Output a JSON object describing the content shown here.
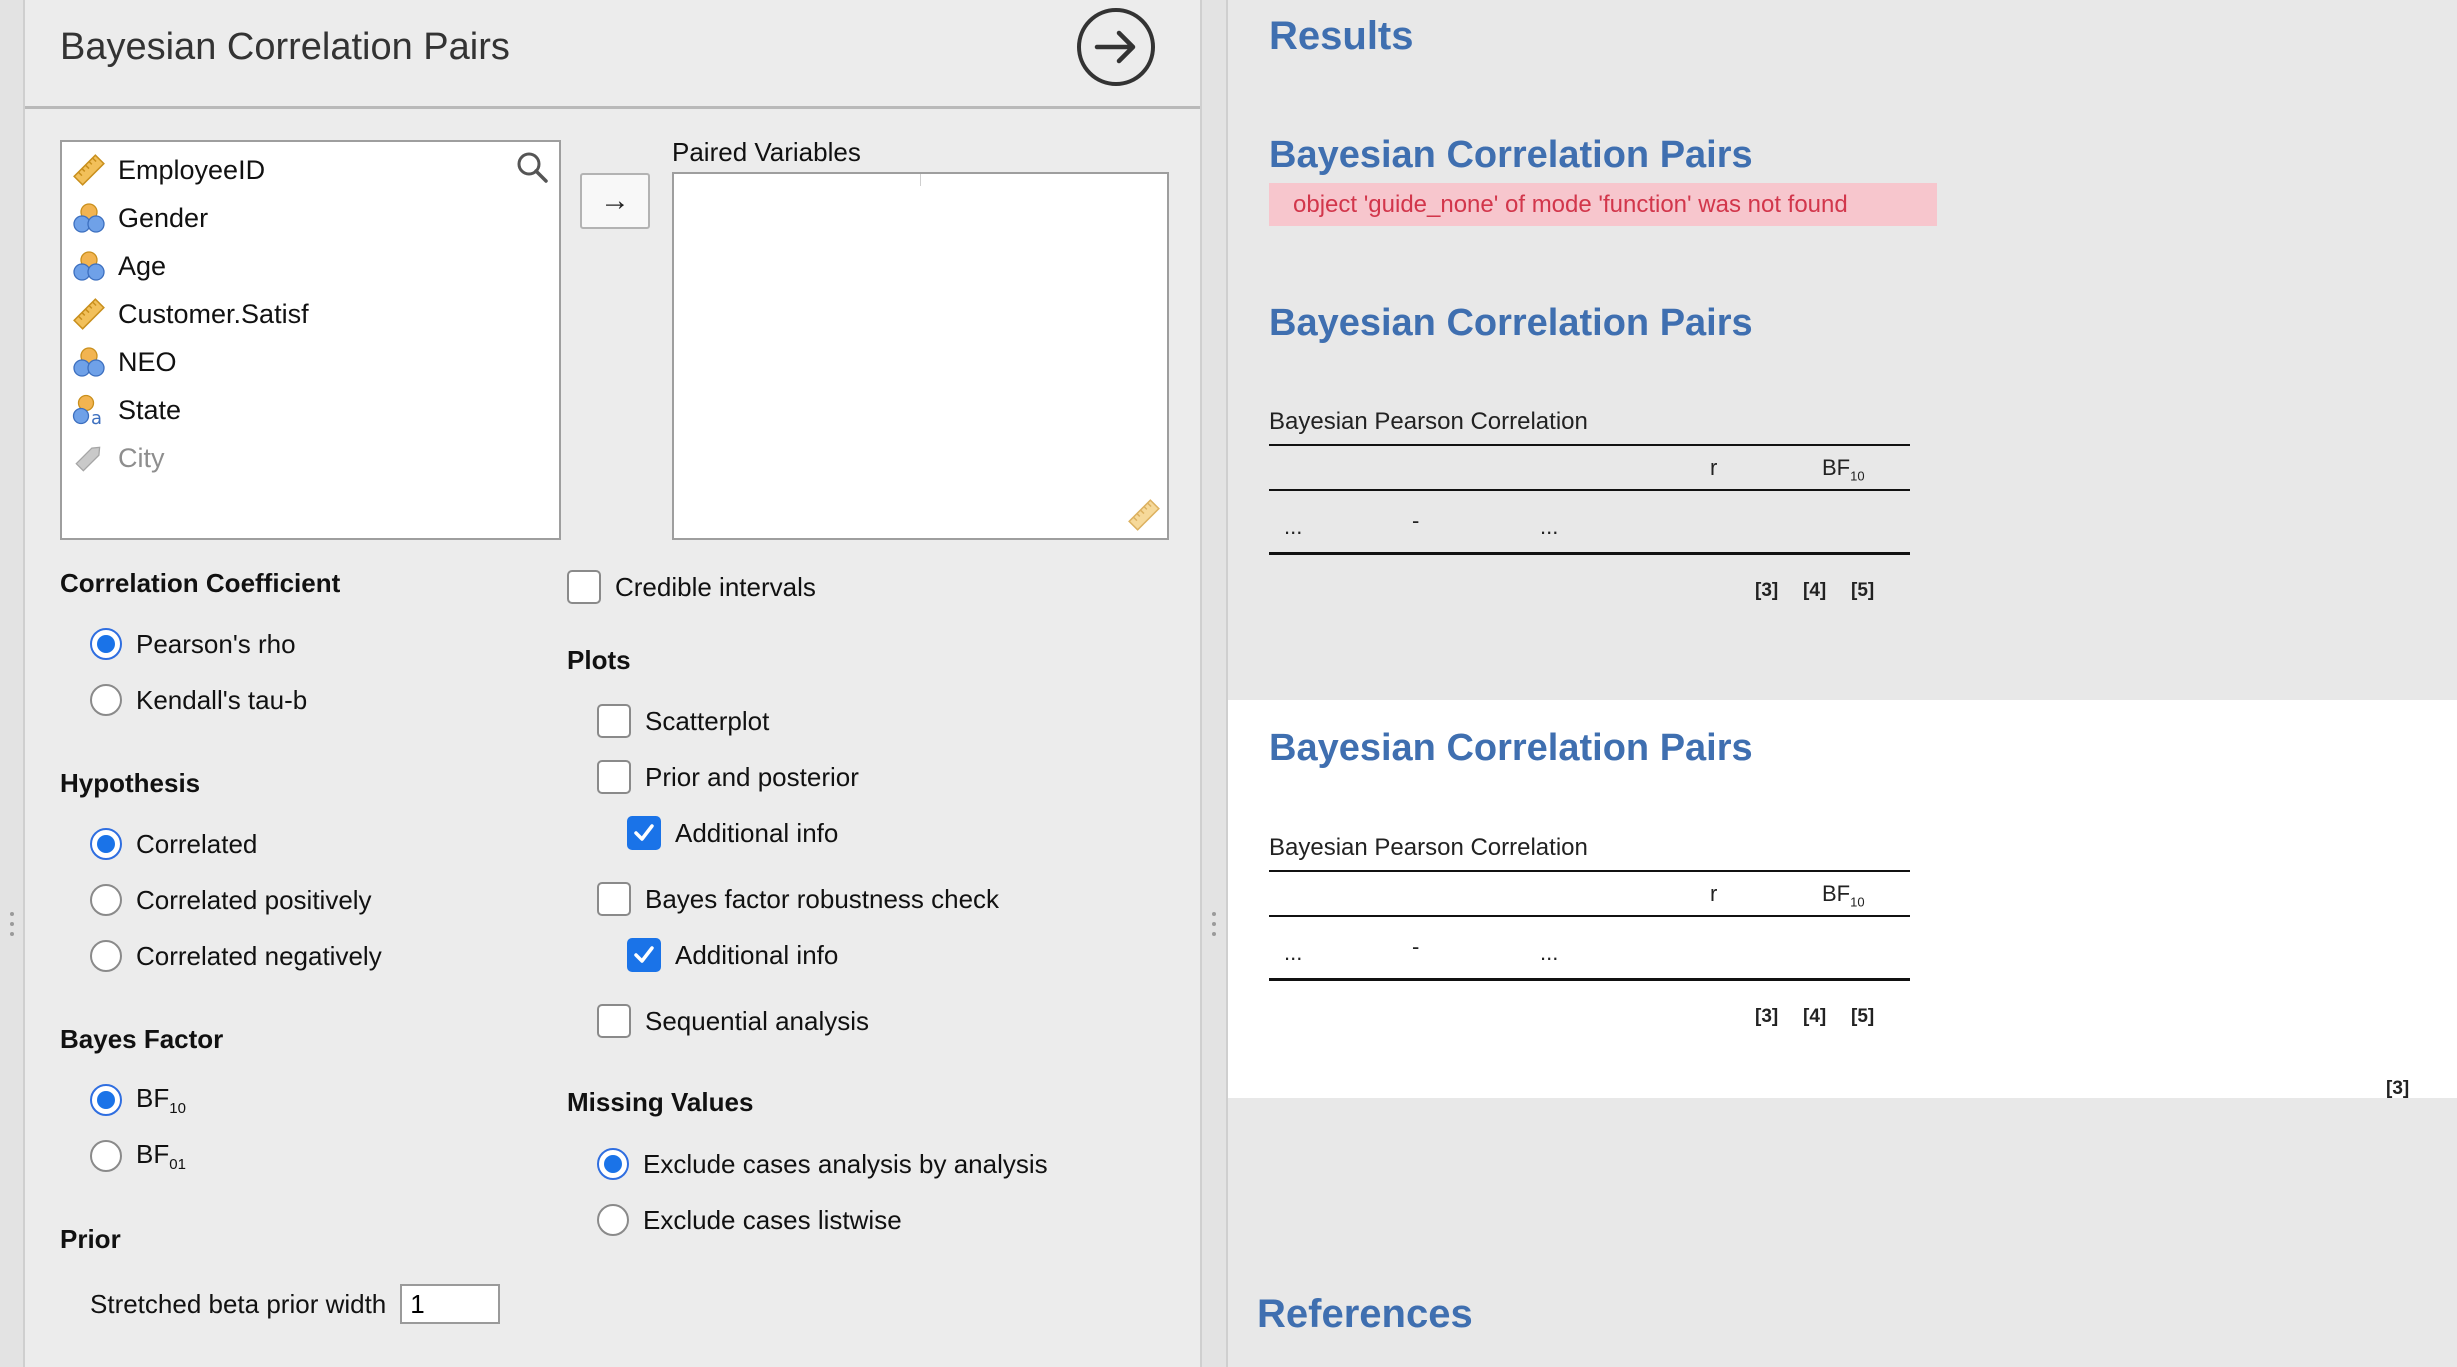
{
  "analysis": {
    "title": "Bayesian Correlation Pairs"
  },
  "variables": [
    {
      "name": "EmployeeID",
      "icon": "scale-icon",
      "enabled": true
    },
    {
      "name": "Gender",
      "icon": "nominal-icon",
      "enabled": true
    },
    {
      "name": "Age",
      "icon": "nominal-icon",
      "enabled": true
    },
    {
      "name": "Customer.Satisf",
      "icon": "scale-icon",
      "enabled": true
    },
    {
      "name": "NEO",
      "icon": "nominal-icon",
      "enabled": true
    },
    {
      "name": "State",
      "icon": "nominal-text-icon",
      "enabled": true
    },
    {
      "name": "City",
      "icon": "text-icon",
      "enabled": false
    }
  ],
  "paired": {
    "label": "Paired Variables",
    "move_glyph": "→"
  },
  "correlation": {
    "label": "Correlation Coefficient",
    "options": [
      "Pearson's rho",
      "Kendall's tau-b"
    ],
    "selected": 0
  },
  "hypothesis": {
    "label": "Hypothesis",
    "options": [
      "Correlated",
      "Correlated positively",
      "Correlated negatively"
    ],
    "selected": 0
  },
  "bayes_factor": {
    "label": "Bayes Factor",
    "options": [
      {
        "main": "BF",
        "sub": "10"
      },
      {
        "main": "BF",
        "sub": "01"
      }
    ],
    "selected": 0
  },
  "prior": {
    "label": "Prior",
    "field_label": "Stretched beta prior width",
    "value": "1"
  },
  "credible_intervals": {
    "label": "Credible intervals",
    "checked": false
  },
  "plots": {
    "label": "Plots",
    "scatterplot": "Scatterplot",
    "prior_posterior": "Prior and posterior",
    "additional_info_1": "Additional info",
    "robustness": "Bayes factor robustness check",
    "additional_info_2": "Additional info",
    "sequential": "Sequential analysis"
  },
  "missing": {
    "label": "Missing Values",
    "options": [
      "Exclude cases analysis by analysis",
      "Exclude cases listwise"
    ],
    "selected": 0
  },
  "results": {
    "heading": "Results",
    "blocks": [
      {
        "title": "Bayesian Correlation Pairs",
        "error": "object 'guide_none' of mode 'function' was not found"
      },
      {
        "title": "Bayesian Correlation Pairs",
        "table_title": "Bayesian Pearson Correlation",
        "col_r": "r",
        "col_bf_main": "BF",
        "col_bf_sub": "10",
        "row": [
          "...",
          "-",
          "..."
        ],
        "footnotes": [
          "[3]",
          "[4]",
          "[5]"
        ]
      },
      {
        "title": "Bayesian Correlation Pairs",
        "table_title": "Bayesian Pearson Correlation",
        "col_r": "r",
        "col_bf_main": "BF",
        "col_bf_sub": "10",
        "row": [
          "...",
          "-",
          "..."
        ],
        "footnotes": [
          "[3]",
          "[4]",
          "[5]"
        ],
        "extra_footnote": "[3]"
      }
    ],
    "references": "References"
  },
  "colors": {
    "accent": "#1a73e8",
    "heading": "#3f6fb0",
    "error_bg": "#f7c6cd",
    "error_text": "#d2364b"
  }
}
